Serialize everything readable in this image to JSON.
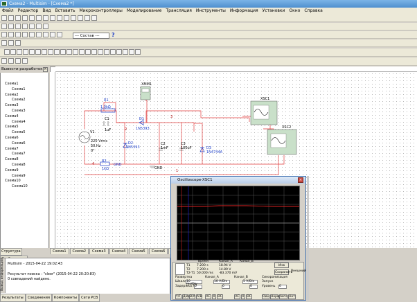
{
  "window": {
    "title": "Схема2 - Multisim - [Схема2 *]"
  },
  "menu": [
    "Файл",
    "Редактор",
    "Вид",
    "Вставить",
    "Микроконтроллеры",
    "Моделирование",
    "Трансляция",
    "Инструменты",
    "Информация",
    "Установки",
    "Окно",
    "Справка"
  ],
  "toolbar": {
    "select_value": "--- Состав ---",
    "help": "?"
  },
  "left_panel": {
    "header": "Вывести разработок",
    "tree": [
      "Схема1",
      "Схема1",
      "Схема2",
      "Схема2",
      "Схема3",
      "Схема3",
      "Схема4",
      "Схема4",
      "Схема5",
      "Схема5",
      "Схема6",
      "Схема6",
      "Схема7",
      "Схема7",
      "Схема8",
      "Схема8",
      "Схема9",
      "Схема9",
      "Схема10",
      "Схема10"
    ],
    "tabs": [
      "Структура",
      "Отображение"
    ]
  },
  "doc_tabs": [
    "Схема1",
    "Схема2",
    "Схема3",
    "Схема4",
    "Схема5",
    "Схема6",
    "Схема7"
  ],
  "circuit": {
    "R1": "R1",
    "R1v": "1.0kΩ",
    "C1": "C1",
    "C1v": "1uF",
    "D1": "D1",
    "D1v": "1N5393",
    "D2": "D2",
    "D2v": "1N5393",
    "C2": "C2",
    "C2v": "1mF",
    "C3": "C3",
    "C3v": "100uF",
    "D3": "D3",
    "D3v": "1N4744A",
    "V1": "V1",
    "V1a": "220 Vrms",
    "V1b": "50 Hz",
    "V1c": "0°",
    "R2": "R2",
    "R2v": "1kΩ",
    "XMM1": "XMM1",
    "XSC1": "XSC1",
    "XSC2": "XSC2",
    "GND": "GND",
    "n1": "1",
    "n2": "2",
    "n3": "3",
    "n4": "4"
  },
  "output": {
    "title": "Multisim - 2015-04-22 19:02:43",
    "line1": "Результат поиска : \"sleer\" (2015-04-22 20:20:83)",
    "line2": "0 совпадений найдено.",
    "tabs": [
      "Результаты",
      "Соединения",
      "Компоненты",
      "Сети PCB"
    ],
    "side": "Вывод информации"
  },
  "oscilloscope": {
    "title": "Oscilloscope-XSC1",
    "t1": "T1",
    "t2": "T2",
    "t2t1": "T2-T1",
    "time_col": "Время",
    "chA_col": "Канал_A",
    "chB_col": "Канал_B",
    "t1_time": "7.200 s",
    "t2_time": "7.200 s",
    "dt": "50.000 ms",
    "t1_a": "18.94 V",
    "t2_a": "14.89 V",
    "dt_a": "-83.370 mV",
    "reverse_btn": "Инв",
    "save_btn": "Сохранить",
    "ext_trigger": "Внешний",
    "timebase_label": "Развертка",
    "scale_label": "Шкала",
    "scale_val": "10 ms/Div",
    "xpos_label": "Задержка X",
    "xpos_val": "0",
    "cha_label": "Канал_A",
    "cha_scale": "10 V/Div",
    "cha_ypos": "0",
    "chb_label": "Канал_B",
    "chb_scale": "5 V/Div",
    "chb_ypos": "0",
    "trig_label": "Синхронизация",
    "edge_label": "Запуск",
    "level_label": "Уровень",
    "level_val": "0",
    "modes": [
      "Y/T",
      "Доб",
      "B/A",
      "A/B"
    ],
    "coupling": [
      "AC",
      "0",
      "DC"
    ],
    "trig_modes": [
      "Одн",
      "Норм",
      "Авто",
      "Нет"
    ]
  }
}
